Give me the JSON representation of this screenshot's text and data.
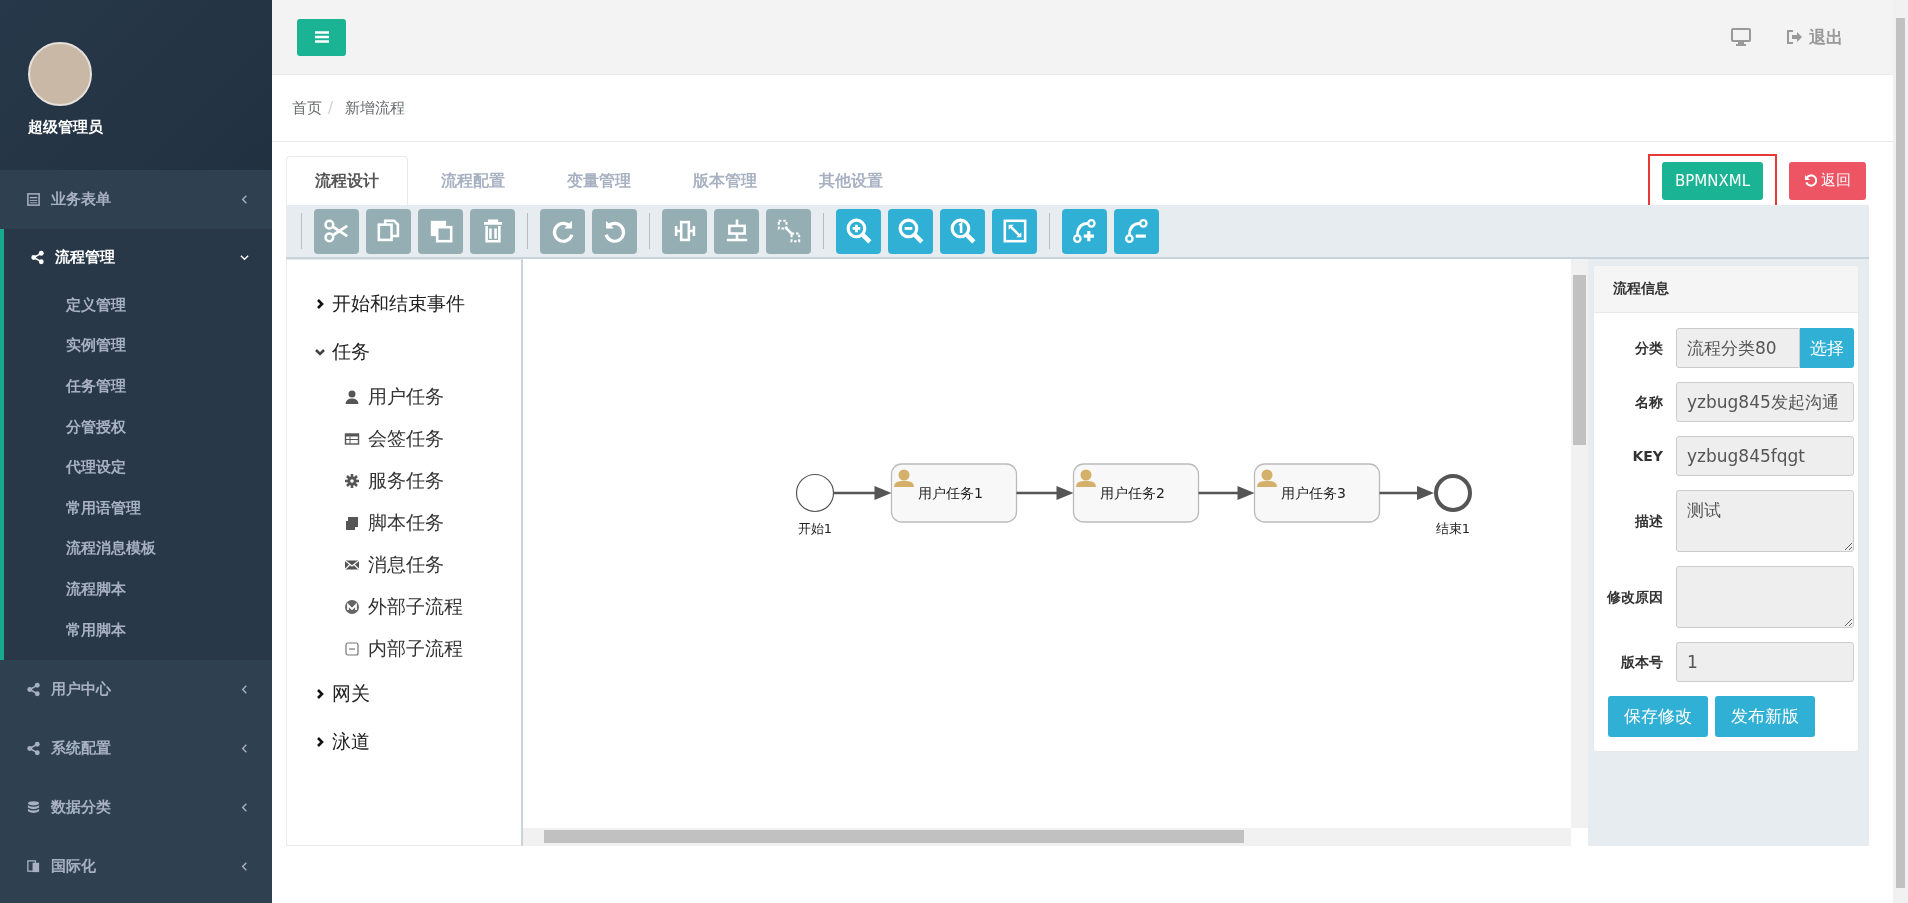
{
  "sidebar": {
    "user_name": "超级管理员",
    "menu": [
      {
        "label": "业务表单",
        "kind": "form",
        "expanded": false
      },
      {
        "label": "流程管理",
        "kind": "share",
        "expanded": true,
        "children": [
          {
            "label": "定义管理"
          },
          {
            "label": "实例管理"
          },
          {
            "label": "任务管理"
          },
          {
            "label": "分管授权"
          },
          {
            "label": "代理设定"
          },
          {
            "label": "常用语管理"
          },
          {
            "label": "流程消息模板"
          },
          {
            "label": "流程脚本"
          },
          {
            "label": "常用脚本"
          }
        ]
      },
      {
        "label": "用户中心",
        "kind": "share",
        "expanded": false
      },
      {
        "label": "系统配置",
        "kind": "share",
        "expanded": false
      },
      {
        "label": "数据分类",
        "kind": "database",
        "expanded": false
      },
      {
        "label": "国际化",
        "kind": "language",
        "expanded": false
      }
    ]
  },
  "topbar": {
    "logout": "退出"
  },
  "breadcrumb": {
    "items": [
      "首页",
      "新增流程"
    ],
    "separator": "/"
  },
  "tabs": [
    {
      "label": "流程设计",
      "selected": true
    },
    {
      "label": "流程配置",
      "selected": false
    },
    {
      "label": "变量管理",
      "selected": false
    },
    {
      "label": "版本管理",
      "selected": false
    },
    {
      "label": "其他设置",
      "selected": false
    }
  ],
  "actions": [
    {
      "label": "BPMNXML",
      "kind": "xml",
      "highlighted": true
    },
    {
      "label": "返回",
      "kind": "back",
      "highlighted": false
    }
  ],
  "palette": [
    {
      "label": "开始和结束事件",
      "expanded": false
    },
    {
      "label": "任务",
      "expanded": true,
      "children": [
        {
          "label": "用户任务",
          "kind": "user"
        },
        {
          "label": "会签任务",
          "kind": "table"
        },
        {
          "label": "服务任务",
          "kind": "gear"
        },
        {
          "label": "脚本任务",
          "kind": "script"
        },
        {
          "label": "消息任务",
          "kind": "message"
        },
        {
          "label": "外部子流程",
          "kind": "external"
        },
        {
          "label": "内部子流程",
          "kind": "internal"
        }
      ]
    },
    {
      "label": "网关",
      "expanded": false
    },
    {
      "label": "泳道",
      "expanded": false
    }
  ],
  "diagram": {
    "nodes": [
      {
        "kind": "start",
        "label": "开始1"
      },
      {
        "kind": "user_task",
        "label": "用户任务1"
      },
      {
        "kind": "user_task",
        "label": "用户任务2"
      },
      {
        "kind": "user_task",
        "label": "用户任务3"
      },
      {
        "kind": "end",
        "label": "结束1"
      }
    ]
  },
  "process_info": {
    "title": "流程信息",
    "fields": [
      {
        "label": "分类",
        "kind": "select",
        "value": "流程分类80",
        "button": "选择"
      },
      {
        "label": "名称",
        "kind": "text",
        "value": "yzbug845发起沟通"
      },
      {
        "label": "KEY",
        "kind": "text",
        "value": "yzbug845fqgt"
      },
      {
        "label": "描述",
        "kind": "textarea",
        "value": "测试"
      },
      {
        "label": "修改原因",
        "kind": "textarea"
      },
      {
        "label": "版本号",
        "kind": "text",
        "value": "1"
      }
    ],
    "buttons": [
      "保存修改",
      "发布新版"
    ]
  }
}
